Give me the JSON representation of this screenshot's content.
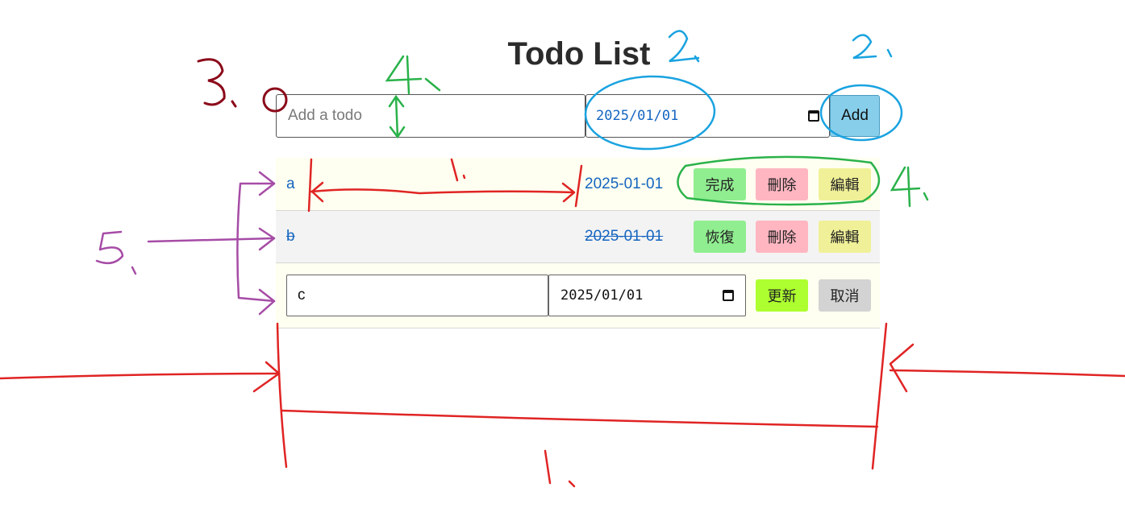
{
  "header": {
    "title": "Todo List"
  },
  "add_form": {
    "text_placeholder": "Add a todo",
    "date_value": "2025/01/01",
    "add_label": "Add"
  },
  "todos": [
    {
      "text": "a",
      "date": "2025-01-01",
      "done": false,
      "buttons": [
        "完成",
        "刪除",
        "編輯"
      ]
    },
    {
      "text": "b",
      "date": "2025-01-01",
      "done": true,
      "buttons": [
        "恢復",
        "刪除",
        "編輯"
      ]
    }
  ],
  "editing": {
    "text_value": "c",
    "date_value": "2025/01/01",
    "buttons": [
      "更新",
      "取消"
    ]
  },
  "annotations": {
    "numbers": [
      "1.",
      "1.",
      "2.",
      "2.",
      "3.",
      "4.",
      "4.",
      "5."
    ],
    "colors": {
      "red": "#e02424",
      "blue": "#1aa3e0",
      "green": "#2ab24a",
      "purple": "#a64ca6",
      "maroon": "#8b0a1a"
    }
  }
}
